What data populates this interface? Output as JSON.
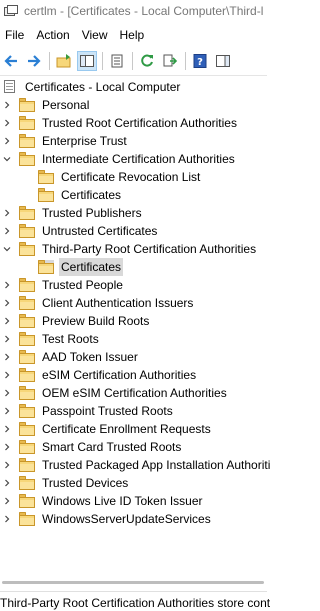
{
  "window": {
    "title": "certlm - [Certificates - Local Computer\\Third-l"
  },
  "menu": {
    "items": [
      "File",
      "Action",
      "View",
      "Help"
    ]
  },
  "toolbar": {
    "buttons": [
      "back-arrow-icon",
      "forward-arrow-icon",
      "up-folder-icon",
      "show-hide-console-tree-icon",
      "properties-icon",
      "copy-icon",
      "refresh-icon",
      "export-list-icon",
      "help-icon",
      "show-action-pane-icon"
    ]
  },
  "tree": {
    "root": {
      "label": "Certificates - Local Computer"
    },
    "items": [
      {
        "label": "Personal",
        "expander": "collapsed",
        "depth": 1
      },
      {
        "label": "Trusted Root Certification Authorities",
        "expander": "collapsed",
        "depth": 1
      },
      {
        "label": "Enterprise Trust",
        "expander": "collapsed",
        "depth": 1
      },
      {
        "label": "Intermediate Certification Authorities",
        "expander": "expanded",
        "depth": 1
      },
      {
        "label": "Certificate Revocation List",
        "expander": "none",
        "depth": 2
      },
      {
        "label": "Certificates",
        "expander": "none",
        "depth": 2
      },
      {
        "label": "Trusted Publishers",
        "expander": "collapsed",
        "depth": 1
      },
      {
        "label": "Untrusted Certificates",
        "expander": "collapsed",
        "depth": 1
      },
      {
        "label": "Third-Party Root Certification Authorities",
        "expander": "expanded",
        "depth": 1
      },
      {
        "label": "Certificates",
        "expander": "none",
        "depth": 2,
        "selected": true
      },
      {
        "label": "Trusted People",
        "expander": "collapsed",
        "depth": 1
      },
      {
        "label": "Client Authentication Issuers",
        "expander": "collapsed",
        "depth": 1
      },
      {
        "label": "Preview Build Roots",
        "expander": "collapsed",
        "depth": 1
      },
      {
        "label": "Test Roots",
        "expander": "collapsed",
        "depth": 1
      },
      {
        "label": "AAD Token Issuer",
        "expander": "collapsed",
        "depth": 1
      },
      {
        "label": "eSIM Certification Authorities",
        "expander": "collapsed",
        "depth": 1
      },
      {
        "label": "OEM eSIM Certification Authorities",
        "expander": "collapsed",
        "depth": 1
      },
      {
        "label": "Passpoint Trusted Roots",
        "expander": "collapsed",
        "depth": 1
      },
      {
        "label": "Certificate Enrollment Requests",
        "expander": "collapsed",
        "depth": 1
      },
      {
        "label": "Smart Card Trusted Roots",
        "expander": "collapsed",
        "depth": 1
      },
      {
        "label": "Trusted Packaged App Installation Authoriti",
        "expander": "collapsed",
        "depth": 1
      },
      {
        "label": "Trusted Devices",
        "expander": "collapsed",
        "depth": 1
      },
      {
        "label": "Windows Live ID Token Issuer",
        "expander": "collapsed",
        "depth": 1
      },
      {
        "label": "WindowsServerUpdateServices",
        "expander": "collapsed",
        "depth": 1
      }
    ]
  },
  "status": {
    "text": "Third-Party Root Certification Authorities store cont"
  },
  "colors": {
    "folder": "#f7d77a",
    "folder_border": "#c9962a",
    "selection": "#d9d9d9",
    "toolbar_active": "#cce4f7"
  }
}
